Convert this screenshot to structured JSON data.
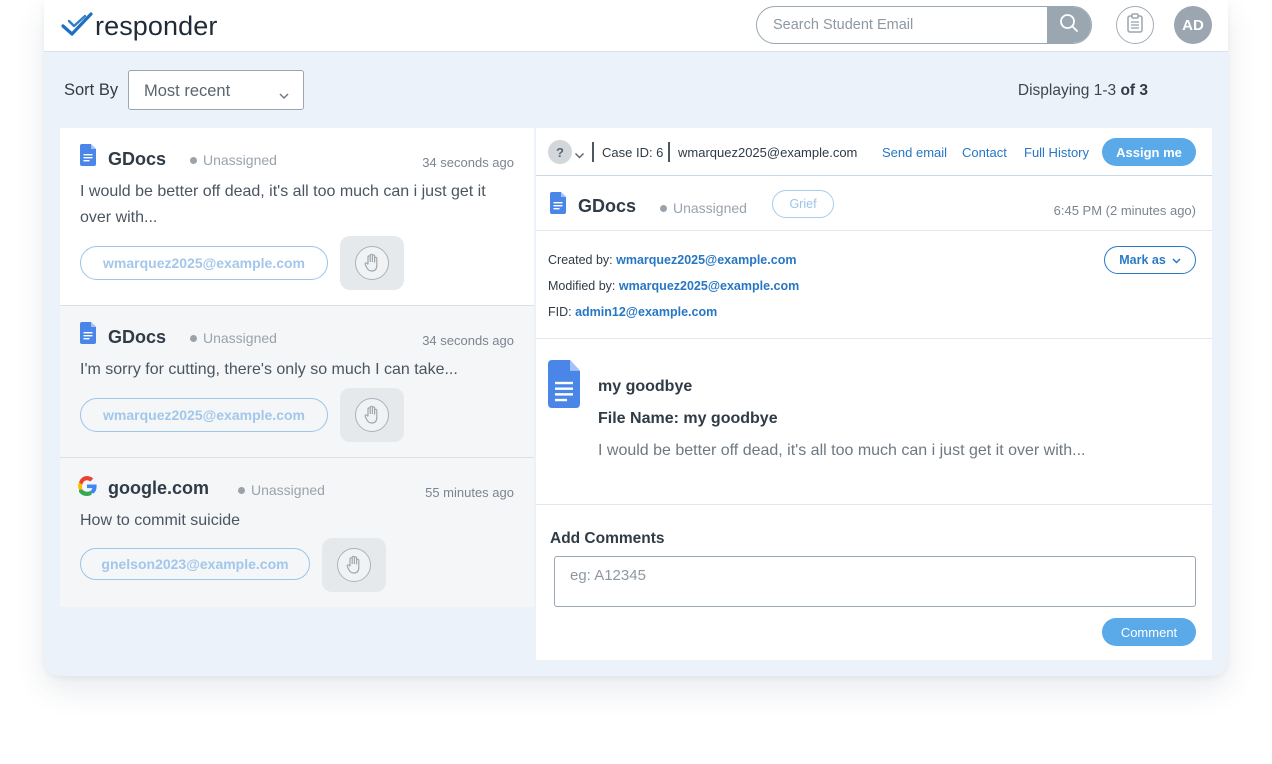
{
  "brand": {
    "name": "responder",
    "color": "#1f6fc2"
  },
  "header": {
    "search_placeholder": "Search Student Email",
    "avatar_initials": "AD"
  },
  "toolbar": {
    "sort_label": "Sort By",
    "sort_value": "Most recent",
    "displaying_prefix": "Displaying 1-3",
    "displaying_total": "of 3"
  },
  "cases": [
    {
      "app": "GDocs",
      "app_icon": "google-docs-icon",
      "status": "Unassigned",
      "time": "34 seconds ago",
      "text": "I would be better off dead, it's all too much can i just get it over with...",
      "email": "wmarquez2025@example.com"
    },
    {
      "app": "GDocs",
      "app_icon": "google-docs-icon",
      "status": "Unassigned",
      "time": "34 seconds ago",
      "text": "I'm sorry for cutting, there's only so much I can take...",
      "email": "wmarquez2025@example.com"
    },
    {
      "app": "google.com",
      "app_icon": "google-g-icon",
      "status": "Unassigned",
      "time": "55 minutes ago",
      "text": "How to commit suicide",
      "email": "gnelson2023@example.com"
    }
  ],
  "detail": {
    "badge": "?",
    "case_id": "Case ID: 6",
    "email": "wmarquez2025@example.com",
    "links": {
      "send_email": "Send email",
      "contact": "Contact",
      "full_history": "Full History"
    },
    "assign_label": "Assign me",
    "app": "GDocs",
    "status": "Unassigned",
    "tag": "Grief",
    "time": "6:45 PM (2 minutes ago)",
    "created_by_label": "Created by:",
    "created_by": "wmarquez2025@example.com",
    "modified_by_label": "Modified by:",
    "modified_by": "wmarquez2025@example.com",
    "fid_label": "FID:",
    "fid": "admin12@example.com",
    "mark_as_label": "Mark as",
    "doc_title": "my goodbye",
    "doc_filename": "File Name: my goodbye",
    "doc_text": "I would be better off dead, it's all too much can i just get it over with..."
  },
  "comments": {
    "label": "Add Comments",
    "placeholder": "eg: A12345",
    "button": "Comment"
  },
  "colors": {
    "accent": "#5aa9e8",
    "link": "#2777c4",
    "background": "#ecf2f9"
  }
}
